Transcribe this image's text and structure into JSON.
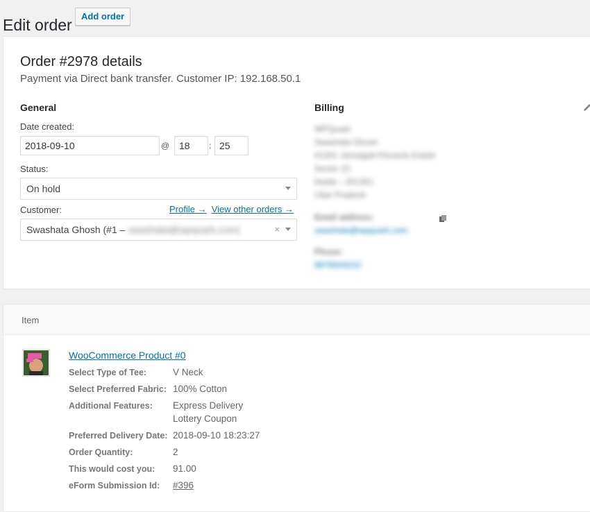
{
  "header": {
    "title": "Edit order",
    "add_order_label": "Add order"
  },
  "order": {
    "heading": "Order #2978 details",
    "subheading": "Payment via Direct bank transfer. Customer IP: 192.168.50.1"
  },
  "general": {
    "title": "General",
    "date_label": "Date created:",
    "date_value": "2018-09-10",
    "at_sep": "@",
    "hour": "18",
    "time_sep": ":",
    "minute": "25",
    "status_label": "Status:",
    "status_value": "On hold",
    "customer_label": "Customer:",
    "profile_link": "Profile →",
    "other_orders_link": "View other orders →",
    "customer_value": "Swashata Ghosh (#1 –",
    "customer_email_blurred": "swashata@wpquark.com)",
    "clear_symbol": "×"
  },
  "billing": {
    "title": "Billing",
    "address_lines": [
      "WPQuark",
      "Swashata Ghosh",
      "#1001 Jamaigali Pinnacle Estate",
      "Sector 15",
      "Noida – 201301",
      "Uttar Pradesh"
    ],
    "email_label": "Email address:",
    "email_value": "swashata@wpquark.com",
    "phone_label": "Phone:",
    "phone_value": "9876543210"
  },
  "items": {
    "header": "Item",
    "product_name": "WooCommerce Product #0",
    "meta": [
      {
        "label": "Select Type of Tee:",
        "value": "V Neck"
      },
      {
        "label": "Select Preferred Fabric:",
        "value": "100% Cotton"
      },
      {
        "label": "Additional Features:",
        "value": "Express Delivery",
        "value2": "Lottery Coupon"
      },
      {
        "label": "Preferred Delivery Date:",
        "value": "2018-09-10 18:23:27"
      },
      {
        "label": "Order Quantity:",
        "value": "2"
      },
      {
        "label": "This would cost you:",
        "value": "91.00"
      },
      {
        "label": "eForm Submission Id:",
        "value": "#396"
      }
    ]
  },
  "icons": {
    "edit": "pencil-icon",
    "copy": "copy-icon",
    "dropdown": "chevron-down-icon"
  },
  "colors": {
    "link": "#0073aa",
    "background": "#f1f1f1"
  }
}
